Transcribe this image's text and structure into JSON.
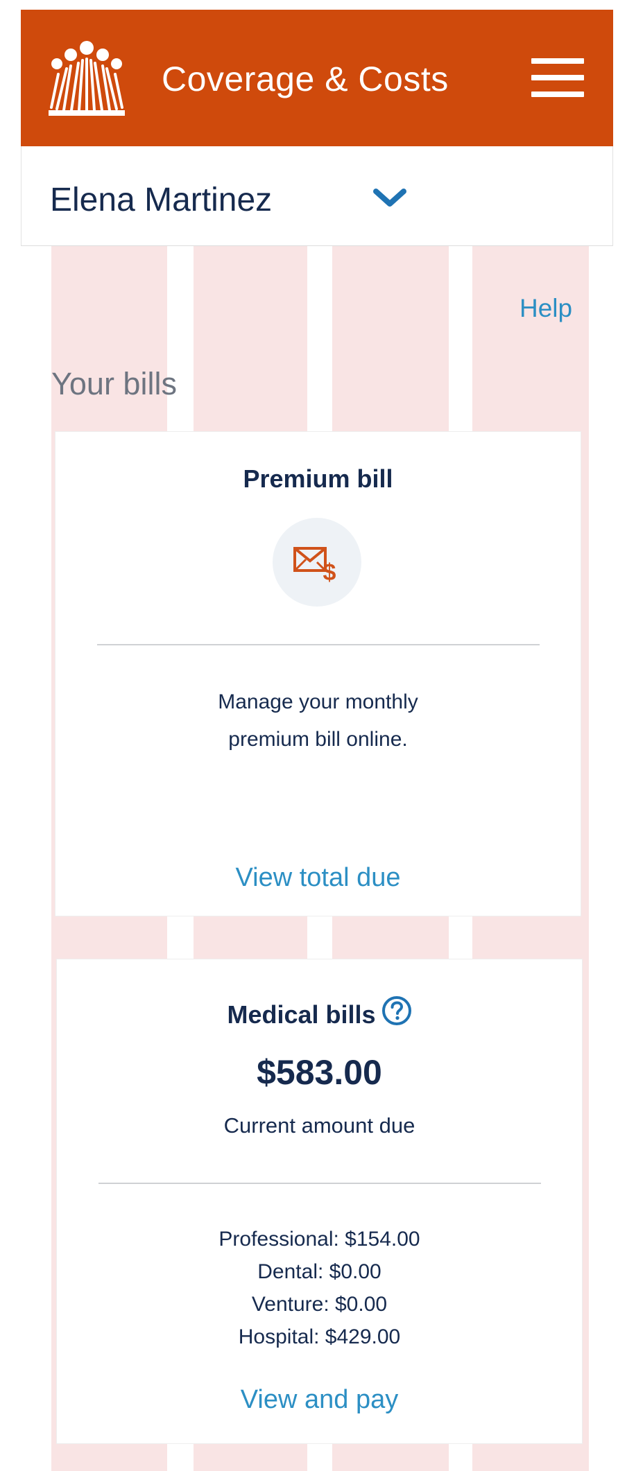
{
  "header": {
    "title": "Coverage & Costs",
    "brand_color": "#cf4a0c",
    "logo_icon": "kaiser-logo-icon",
    "menu_icon": "hamburger-menu-icon"
  },
  "member": {
    "name": "Elena Martinez",
    "dropdown_icon": "chevron-down-icon"
  },
  "help_label": "Help",
  "section_title": "Your bills",
  "premium_card": {
    "title": "Premium bill",
    "icon": "envelope-dollar-icon",
    "description_line1": "Manage your monthly",
    "description_line2": "premium bill online.",
    "action_label": "View total due"
  },
  "medical_card": {
    "title": "Medical bills",
    "help_icon": "question-circle-icon",
    "amount": "$583.00",
    "amount_caption": "Current amount due",
    "breakdown": [
      "Professional: $154.00",
      "Dental: $0.00",
      "Venture: $0.00",
      "Hospital: $429.00"
    ],
    "action_label": "View and pay"
  },
  "colors": {
    "link": "#2c8fc4",
    "text_dark": "#162a4e",
    "grid_pink": "#f9e4e4"
  }
}
